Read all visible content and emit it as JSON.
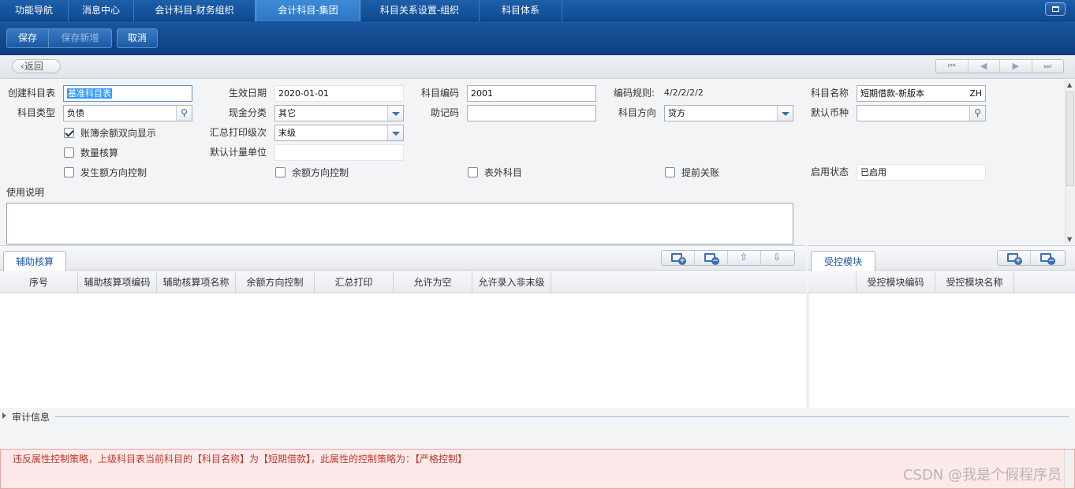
{
  "top_tabs": [
    "功能导航",
    "消息中心",
    "会计科目-财务组织",
    "会计科目-集团",
    "科目关系设置-组织",
    "科目体系"
  ],
  "toolbar": {
    "save": "保存",
    "save_new": "保存新增",
    "cancel": "取消"
  },
  "back_label": "返回",
  "form": {
    "create_table_label": "创建科目表",
    "create_table_value": "基准科目表",
    "effective_date_label": "生效日期",
    "effective_date_value": "2020-01-01",
    "account_code_label": "科目编码",
    "account_code_value": "2001",
    "code_rule_label": "编码规则:",
    "code_rule_value": "4/2/2/2/2",
    "account_name_label": "科目名称",
    "account_name_value": "短期借款-新版本",
    "account_name_lang": "ZH",
    "account_type_label": "科目类型",
    "account_type_value": "负债",
    "cash_class_label": "现金分类",
    "cash_class_value": "其它",
    "mnemonic_label": "助记码",
    "mnemonic_value": "",
    "direction_label": "科目方向",
    "direction_value": "贷方",
    "currency_label": "默认币种",
    "currency_value": "",
    "ledger_balance_label": "账簿余额双向显示",
    "ledger_balance_checked": true,
    "summary_level_label": "汇总打印级次",
    "summary_level_value": "末级",
    "quantity_label": "数量核算",
    "quantity_checked": false,
    "unit_label": "默认计量单位",
    "unit_value": "",
    "occurrence_label": "发生额方向控制",
    "balance_dir_label": "余额方向控制",
    "offbook_label": "表外科目",
    "early_close_label": "提前关账",
    "status_label": "启用状态",
    "status_value": "已启用",
    "usage_label": "使用说明"
  },
  "aux_panel": {
    "tab": "辅助核算",
    "columns": [
      "序号",
      "辅助核算项编码",
      "辅助核算项名称",
      "余额方向控制",
      "汇总打印",
      "允许为空",
      "允许录入非末级"
    ]
  },
  "ctrl_panel": {
    "tab": "受控模块",
    "columns": [
      "受控模块编码",
      "受控模块名称"
    ]
  },
  "audit_label": "审计信息",
  "error_message": "违反属性控制策略，上级科目表当前科目的【科目名称】为【短期借款】，此属性的控制策略为：【严格控制】",
  "watermark": "CSDN @我是个假程序员"
}
